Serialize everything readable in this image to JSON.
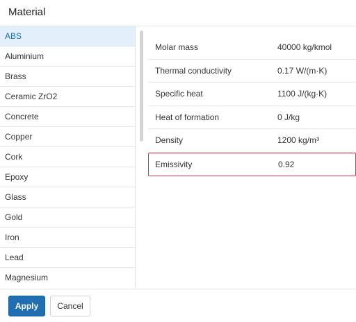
{
  "dialog": {
    "title": "Material"
  },
  "materials": {
    "selected_index": 0,
    "items": [
      "ABS",
      "Aluminium",
      "Brass",
      "Ceramic ZrO2",
      "Concrete",
      "Copper",
      "Cork",
      "Epoxy",
      "Glass",
      "Gold",
      "Iron",
      "Lead",
      "Magnesium"
    ]
  },
  "properties": [
    {
      "label": "Molar mass",
      "value": "40000 kg/kmol"
    },
    {
      "label": "Thermal conductivity",
      "value": "0.17 W/(m·K)"
    },
    {
      "label": "Specific heat",
      "value": "1100 J/(kg·K)"
    },
    {
      "label": "Heat of formation",
      "value": "0 J/kg"
    },
    {
      "label": "Density",
      "value": "1200 kg/m³"
    },
    {
      "label": "Emissivity",
      "value": "0.92"
    }
  ],
  "highlighted_property": "Emissivity",
  "highlight_color": "#d9363e",
  "accent_color": "#1f6fb2",
  "buttons": {
    "apply": "Apply",
    "cancel": "Cancel"
  }
}
